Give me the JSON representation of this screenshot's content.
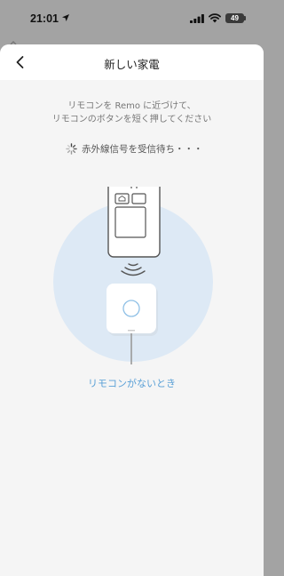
{
  "status_bar": {
    "time": "21:01",
    "battery": "49"
  },
  "nav": {
    "title": "新しい家電",
    "back_icon": "chevron-left-icon"
  },
  "instruction": {
    "line1": "リモコンを Remo に近づけて、",
    "line2": "リモコンのボタンを短く押してください"
  },
  "status": {
    "waiting_text": "赤外線信号を受信待ち・・・",
    "spinner_icon": "loading-spinner-icon"
  },
  "illustration": {
    "circle_color": "#dde9f5",
    "device_color": "#ffffff"
  },
  "link": {
    "no_remote": "リモコンがないとき",
    "color": "#5aa0d6"
  }
}
